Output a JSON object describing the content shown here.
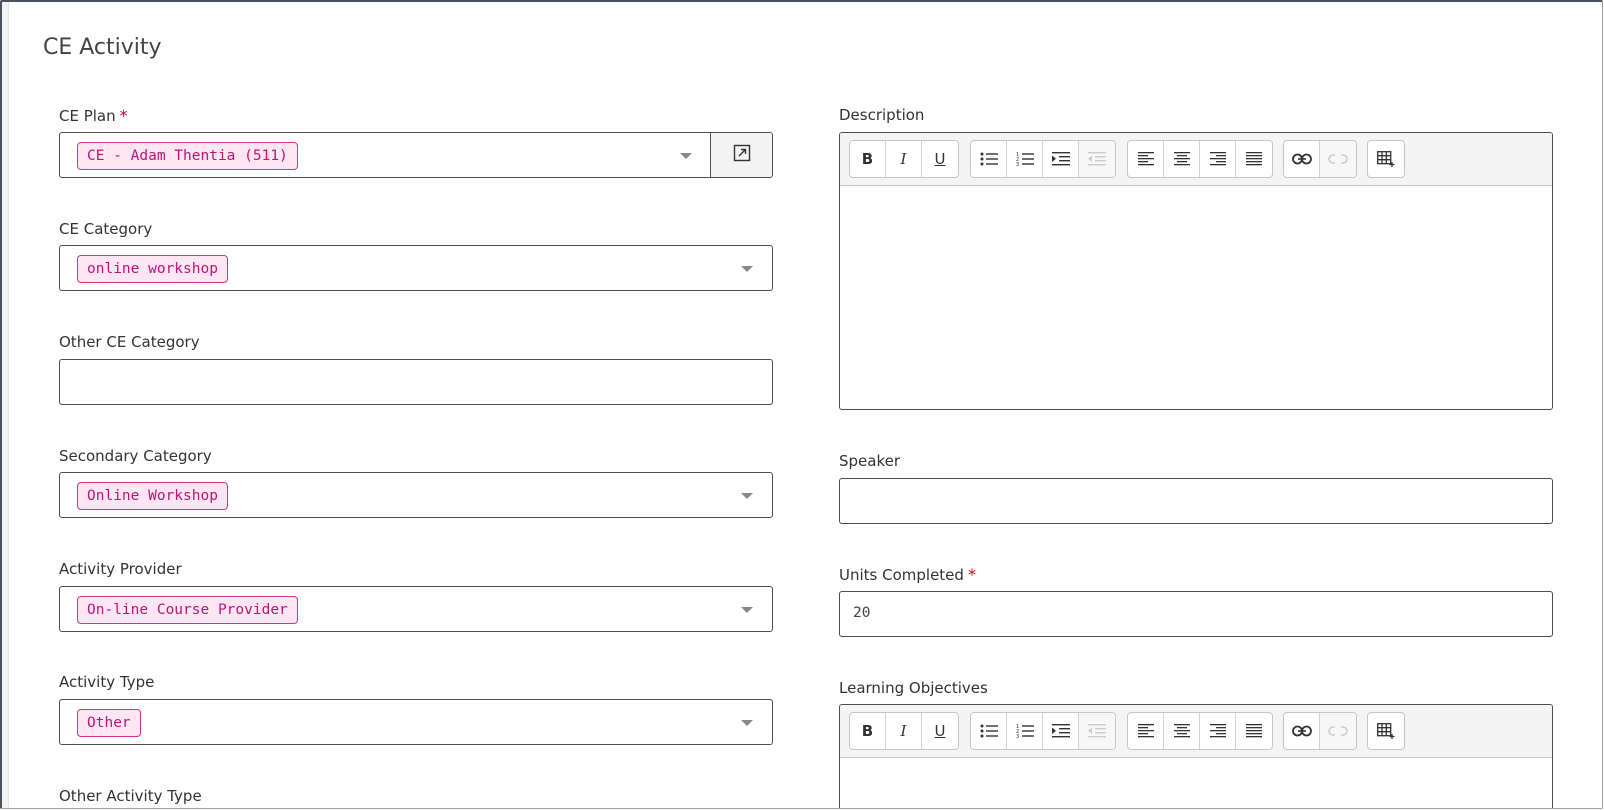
{
  "page": {
    "title": "CE Activity"
  },
  "fields": {
    "ce_plan": {
      "label": "CE Plan",
      "required": "*",
      "value": "CE - Adam Thentia (511)"
    },
    "ce_category": {
      "label": "CE Category",
      "value": "online workshop"
    },
    "other_ce_category": {
      "label": "Other CE Category",
      "value": ""
    },
    "secondary_category": {
      "label": "Secondary Category",
      "value": "Online Workshop"
    },
    "activity_provider": {
      "label": "Activity Provider",
      "value": "On-line Course Provider"
    },
    "activity_type": {
      "label": "Activity Type",
      "value": "Other"
    },
    "other_activity_type": {
      "label": "Other Activity Type"
    },
    "description": {
      "label": "Description"
    },
    "speaker": {
      "label": "Speaker",
      "value": ""
    },
    "units_completed": {
      "label": "Units Completed",
      "required": "*",
      "value": "20"
    },
    "learning_objectives": {
      "label": "Learning Objectives"
    }
  },
  "toolbar": {
    "bold": "B",
    "italic": "I",
    "underline": "U",
    "icons": [
      "bullet-list-icon",
      "numbered-list-icon",
      "indent-icon",
      "outdent-icon",
      "align-left-icon",
      "align-center-icon",
      "align-right-icon",
      "align-justify-icon",
      "link-icon",
      "unlink-icon",
      "insert-table-icon"
    ]
  },
  "colors": {
    "chip_border": "#d4358c",
    "chip_bg": "#fce6f1",
    "chip_text": "#c0137a",
    "required": "#d0021b"
  }
}
